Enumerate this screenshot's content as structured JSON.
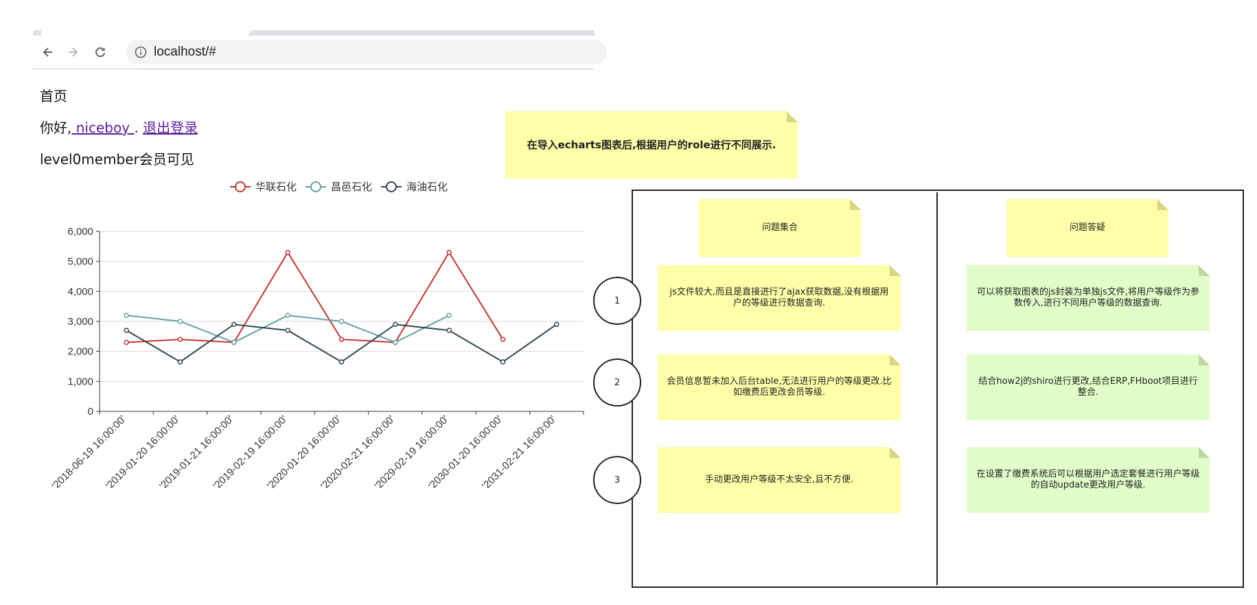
{
  "browser": {
    "url": "localhost/#"
  },
  "page": {
    "home": "首页",
    "greeting_prefix": "你好,",
    "username": " niceboy ",
    "separator": ". ",
    "logout": "退出登录",
    "member_notice": "level0member会员可见"
  },
  "notes": {
    "title": "在导入echarts图表后,根据用户的role进行不同展示.",
    "col_left_header": "问题集合",
    "col_right_header": "问题答疑",
    "rows": [
      {
        "num": "1",
        "problem": "js文件较大,而且是直接进行了ajax获取数据,没有根据用户的等级进行数据查询.",
        "answer": "可以将获取图表的js封装为单独js文件,将用户等级作为参数传入,进行不同用户等级的数据查询."
      },
      {
        "num": "2",
        "problem": "会员信息暂未加入后台table,无法进行用户的等级更改.比如缴费后更改会员等级.",
        "answer": "结合how2j的shiro进行更改,结合ERP,FHboot项目进行整合."
      },
      {
        "num": "3",
        "problem": "手动更改用户等级不太安全,且不方便.",
        "answer": "在设置了缴费系统后可以根据用户选定套餐进行用户等级的自动update更改用户等级."
      }
    ]
  },
  "colors": {
    "series": [
      "#c23531",
      "#61a0a8",
      "#2f4554"
    ],
    "note_yellow": "#ffffa9",
    "note_green": "#e1fdc8"
  },
  "chart_data": {
    "type": "line",
    "legend_position": "top-center",
    "grid": true,
    "ylim": [
      0,
      6000
    ],
    "yticks": [
      "0",
      "1,000",
      "2,000",
      "3,000",
      "4,000",
      "5,000",
      "6,000"
    ],
    "categories": [
      "'2018-06-19 16:00:00'",
      "'2019-01-20 16:00:00'",
      "'2019-01-21 16:00:00'",
      "'2019-02-19 16:00:00'",
      "'2020-01-20 16:00:00'",
      "'2020-02-21 16:00:00'",
      "'2029-02-19 16:00:00'",
      "'2030-01-20 16:00:00'",
      "'2031-02-21 16:00:00'"
    ],
    "series": [
      {
        "name": "华联石化",
        "values": [
          2300,
          2400,
          2300,
          5300,
          2400,
          2300,
          5300,
          2400,
          null
        ]
      },
      {
        "name": "昌邑石化",
        "values": [
          3200,
          3000,
          2300,
          3200,
          3000,
          2300,
          3200,
          null,
          null
        ]
      },
      {
        "name": "海油石化",
        "values": [
          2700,
          1650,
          2900,
          2700,
          1650,
          2900,
          2700,
          1650,
          2900
        ]
      }
    ]
  }
}
